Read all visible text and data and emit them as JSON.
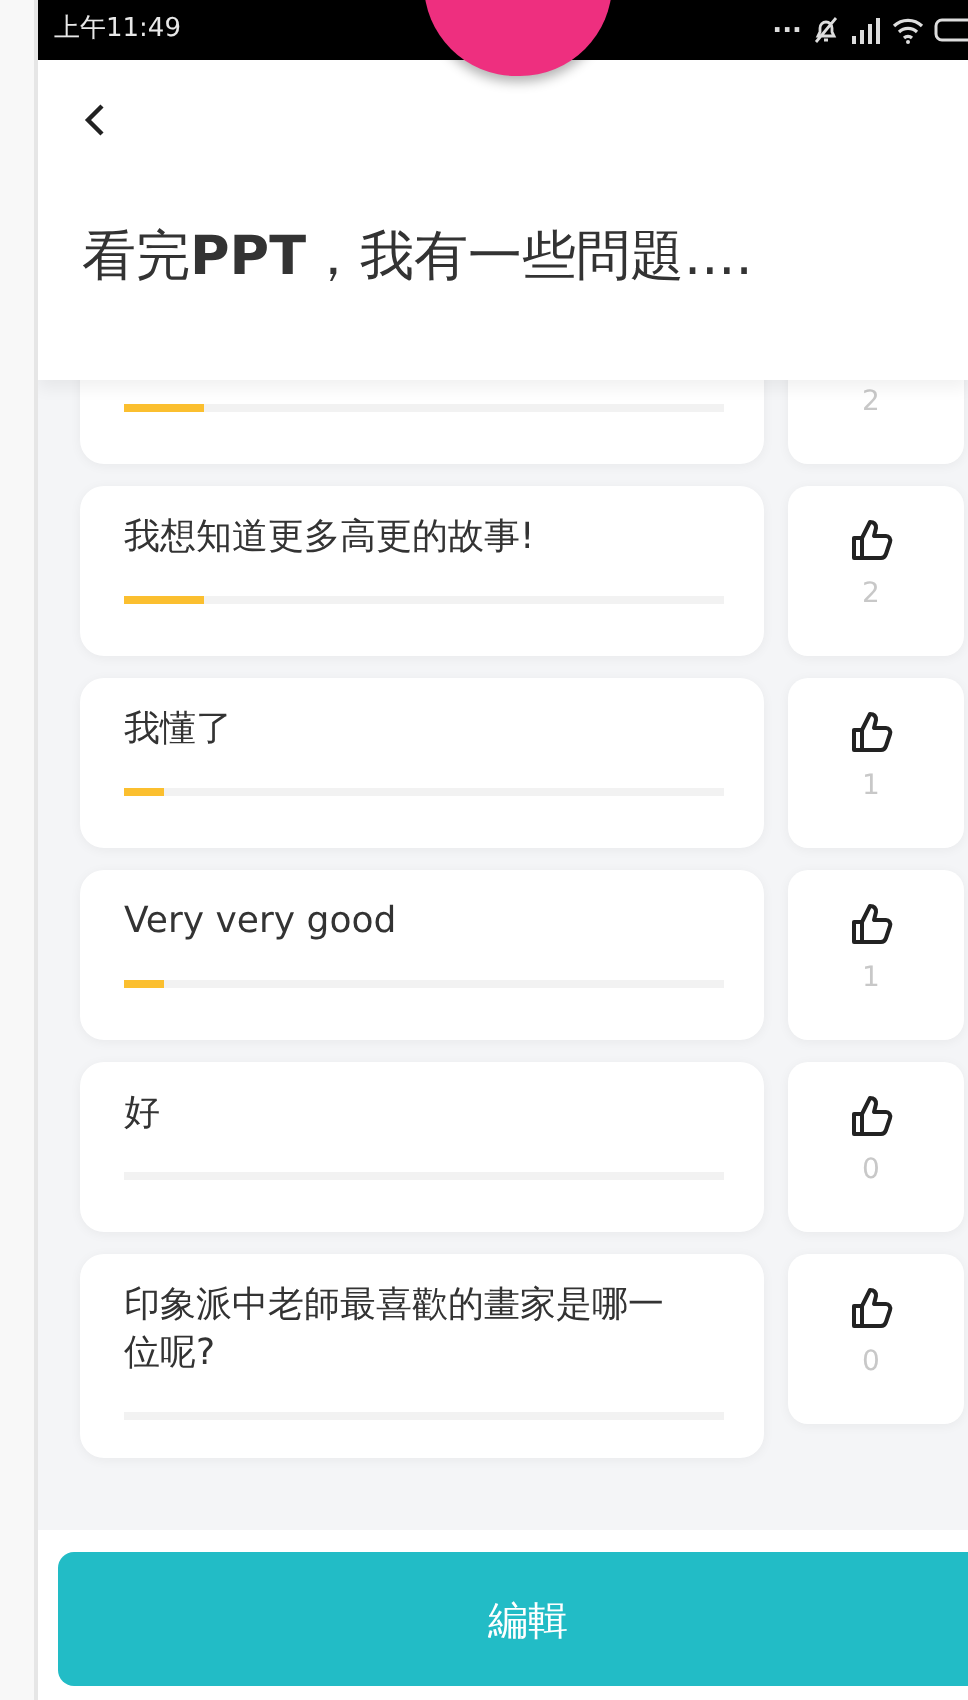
{
  "status_bar": {
    "time": "上午11:49",
    "dots": "..."
  },
  "header": {
    "title": "看完**PPT**，我有一些問題...."
  },
  "questions": [
    {
      "likes": "2",
      "level": 0.133
    },
    {
      "text": "我想知道更多高更的故事!",
      "likes": "2",
      "level": 0.133
    },
    {
      "text": "我懂了",
      "likes": "1",
      "level": 0.067
    },
    {
      "text": "Very very good",
      "likes": "1",
      "level": 0.067
    },
    {
      "text": "好",
      "likes": "0",
      "level": 0
    },
    {
      "text": "印象派中老師最喜歡的畫家是哪一位呢?",
      "likes": "0",
      "level": 0
    }
  ],
  "edit_button": {
    "label": "編輯"
  }
}
